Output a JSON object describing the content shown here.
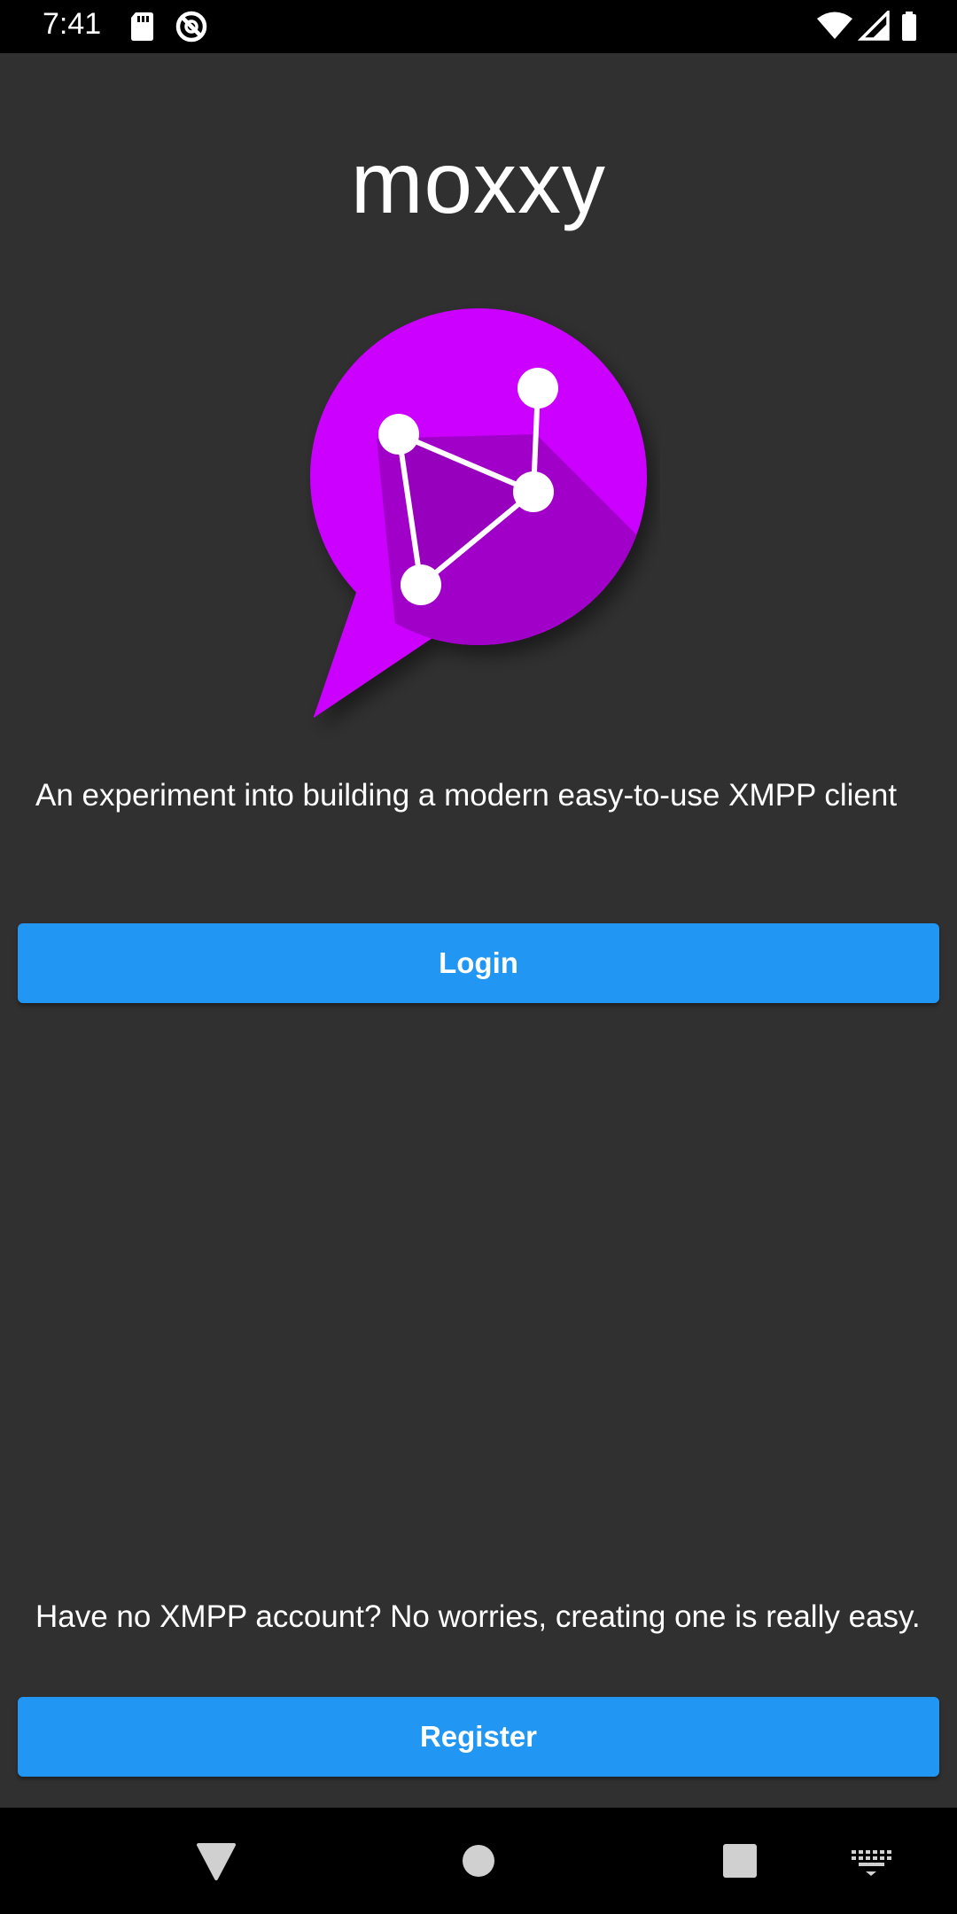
{
  "status_bar": {
    "time": "7:41",
    "left_icons": [
      "sd-card-icon",
      "do-not-disturb-icon"
    ],
    "right_icons": [
      "wifi-icon",
      "cellular-signal-icon",
      "battery-icon"
    ]
  },
  "app": {
    "title": "moxxy",
    "logo_icon": "moxxy-chat-bubble-logo-icon",
    "tagline": "An experiment into building a modern easy-to-use XMPP client",
    "login_label": "Login",
    "register_hint": "Have no XMPP account? No worries, creating one is really easy.",
    "register_label": "Register"
  },
  "nav_bar": {
    "icons": [
      "back-icon",
      "home-icon",
      "recents-icon",
      "keyboard-icon"
    ]
  },
  "colors": {
    "background": "#303030",
    "primary_button": "#2196F3",
    "logo_magenta": "#CC00FF",
    "logo_shadow": "#9900BF",
    "text": "#FFFFFF"
  }
}
